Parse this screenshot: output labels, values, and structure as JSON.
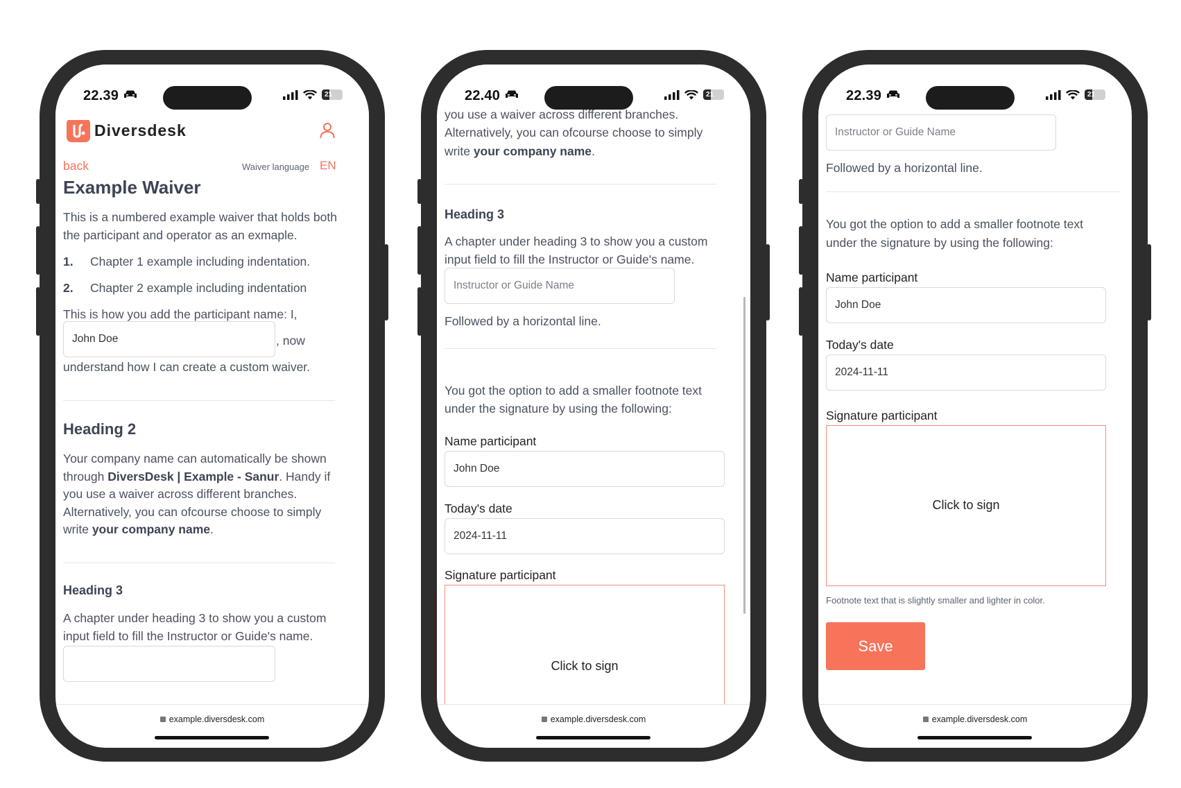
{
  "browser": {
    "url": "example.diversdesk.com"
  },
  "phones": [
    {
      "time": "22.39",
      "battery": "21"
    },
    {
      "time": "22.40",
      "battery": "21"
    },
    {
      "time": "22.39",
      "battery": "21"
    }
  ],
  "app": {
    "brand": "Diversdesk",
    "back_label": "back",
    "language_label": "Waiver language",
    "language_value": "EN"
  },
  "waiver": {
    "title": "Example Waiver",
    "intro_line1": "This is a numbered example waiver that holds both",
    "intro_line2": "the participant and operator as an exmaple.",
    "list": [
      {
        "num": "1.",
        "text": "Chapter 1 example including indentation."
      },
      {
        "num": "2.",
        "text": "Chapter 2 example including indentation"
      }
    ],
    "participant_sentence_start": "This is how you add the participant name: I,",
    "participant_inline_value": "John Doe",
    "participant_sentence_mid": ", now",
    "participant_sentence_end": "understand how I can create a custom waiver.",
    "heading2": "Heading 2",
    "h2_line1": "Your company name can automatically be shown",
    "h2_line2_a": "through ",
    "h2_line2_b": "DiversDesk | Example - Sanur",
    "h2_line2_c": ". Handy if",
    "h2_line3": "you use a waiver across different branches.",
    "h2_line4": "Alternatively, you can ofcourse choose to simply",
    "h2_line5_a": "write ",
    "h2_line5_b": "your company name",
    "h2_line5_c": ".",
    "heading3": "Heading 3",
    "h3_line1": "A chapter under heading 3 to show you a custom",
    "h3_line2": "input field to fill the Instructor or Guide's name.",
    "instructor_placeholder": "Instructor or Guide Name",
    "followed_line": "Followed by a horizontal line.",
    "footnote_intro_line1": "You got the option to add a smaller footnote text",
    "footnote_intro_line2": "under the signature by using the following:",
    "name_participant_label": "Name participant",
    "name_participant_value": "John Doe",
    "todays_date_label": "Today's date",
    "todays_date_value": "2024-11-11",
    "signature_label": "Signature participant",
    "signature_prompt": "Click to sign",
    "footnote_text": "Footnote text that is slightly smaller and lighter in color.",
    "save_label": "Save"
  },
  "colors": {
    "accent": "#f7735a",
    "text": "#4a5160",
    "frame": "#2d2d2d"
  }
}
